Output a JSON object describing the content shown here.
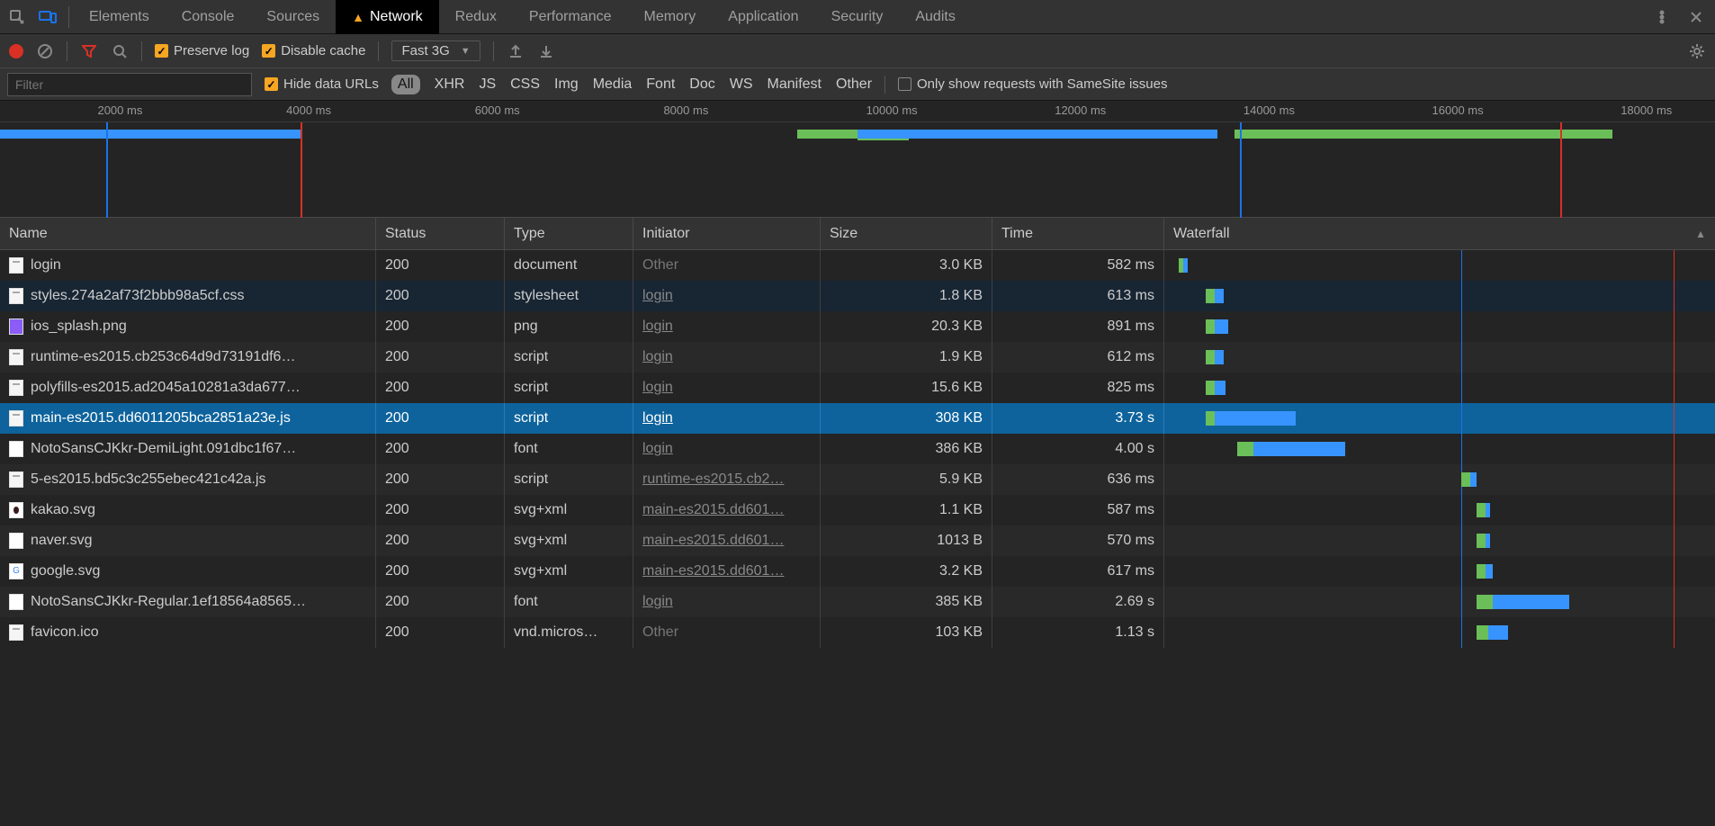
{
  "tabs": [
    "Elements",
    "Console",
    "Sources",
    "Network",
    "Redux",
    "Performance",
    "Memory",
    "Application",
    "Security",
    "Audits"
  ],
  "active_tab": "Network",
  "tab_has_warning": true,
  "toolbar": {
    "preserve_log": "Preserve log",
    "disable_cache": "Disable cache",
    "throttle": "Fast 3G"
  },
  "filter": {
    "placeholder": "Filter",
    "hide_data_urls": "Hide data URLs",
    "categories": [
      "All",
      "XHR",
      "JS",
      "CSS",
      "Img",
      "Media",
      "Font",
      "Doc",
      "WS",
      "Manifest",
      "Other"
    ],
    "active_category": "All",
    "samesite_label": "Only show requests with SameSite issues"
  },
  "timeline": {
    "ticks": [
      "2000 ms",
      "4000 ms",
      "6000 ms",
      "8000 ms",
      "10000 ms",
      "12000 ms",
      "14000 ms",
      "16000 ms",
      "18000 ms"
    ],
    "tick_positions_pct": [
      7,
      18,
      29,
      40,
      52,
      63,
      74,
      85,
      96
    ],
    "markers": [
      {
        "pos_pct": 6.2,
        "color": "#1a73e8"
      },
      {
        "pos_pct": 17.5,
        "color": "#d93025"
      },
      {
        "pos_pct": 72.3,
        "color": "#1a73e8"
      },
      {
        "pos_pct": 91,
        "color": "#d93025"
      }
    ],
    "bars": [
      {
        "left_pct": 0,
        "width_pct": 17.5,
        "color": "#3794ff"
      },
      {
        "left_pct": 46.5,
        "width_pct": 3.5,
        "color": "#6bbf59"
      },
      {
        "left_pct": 50,
        "width_pct": 3,
        "color": "#6bbf59",
        "h": 12
      },
      {
        "left_pct": 50,
        "width_pct": 21,
        "color": "#3794ff"
      },
      {
        "left_pct": 72,
        "width_pct": 22,
        "color": "#6bbf59"
      }
    ]
  },
  "columns": [
    "Name",
    "Status",
    "Type",
    "Initiator",
    "Size",
    "Time",
    "Waterfall"
  ],
  "sort_column": "Waterfall",
  "wf_markers": [
    {
      "pos_pct": 54,
      "color": "#1a73e8"
    },
    {
      "pos_pct": 94,
      "color": "#d93025"
    }
  ],
  "rows": [
    {
      "name": "login",
      "status": "200",
      "type": "document",
      "initiator": "Other",
      "init_link": false,
      "size": "3.0 KB",
      "time": "582 ms",
      "ico": "doc",
      "wf": {
        "l": 1,
        "w1": 2,
        "w2": 2
      }
    },
    {
      "name": "styles.274a2af73f2bbb98a5cf.css",
      "status": "200",
      "type": "stylesheet",
      "initiator": "login",
      "init_link": true,
      "size": "1.8 KB",
      "time": "613 ms",
      "ico": "doc",
      "hover_dark": true,
      "wf": {
        "l": 6,
        "w1": 4,
        "w2": 4
      }
    },
    {
      "name": "ios_splash.png",
      "status": "200",
      "type": "png",
      "initiator": "login",
      "init_link": true,
      "size": "20.3 KB",
      "time": "891 ms",
      "ico": "img",
      "wf": {
        "l": 6,
        "w1": 4,
        "w2": 6
      }
    },
    {
      "name": "runtime-es2015.cb253c64d9d73191df6…",
      "status": "200",
      "type": "script",
      "initiator": "login",
      "init_link": true,
      "size": "1.9 KB",
      "time": "612 ms",
      "ico": "doc",
      "wf": {
        "l": 6,
        "w1": 4,
        "w2": 4
      }
    },
    {
      "name": "polyfills-es2015.ad2045a10281a3da677…",
      "status": "200",
      "type": "script",
      "initiator": "login",
      "init_link": true,
      "size": "15.6 KB",
      "time": "825 ms",
      "ico": "doc",
      "wf": {
        "l": 6,
        "w1": 4,
        "w2": 5
      }
    },
    {
      "name": "main-es2015.dd6011205bca2851a23e.js",
      "status": "200",
      "type": "script",
      "initiator": "login",
      "init_link": true,
      "size": "308 KB",
      "time": "3.73 s",
      "ico": "doc",
      "selected": true,
      "wf": {
        "l": 6,
        "w1": 4,
        "w2": 36
      }
    },
    {
      "name": "NotoSansCJKkr-DemiLight.091dbc1f67…",
      "status": "200",
      "type": "font",
      "initiator": "login",
      "init_link": true,
      "size": "386 KB",
      "time": "4.00 s",
      "ico": "font",
      "wf": {
        "l": 12,
        "w1": 7,
        "w2": 41
      }
    },
    {
      "name": "5-es2015.bd5c3c255ebec421c42a.js",
      "status": "200",
      "type": "script",
      "initiator": "runtime-es2015.cb2…",
      "init_link": true,
      "size": "5.9 KB",
      "time": "636 ms",
      "ico": "doc",
      "wf": {
        "l": 54,
        "w1": 4,
        "w2": 3
      }
    },
    {
      "name": "kakao.svg",
      "status": "200",
      "type": "svg+xml",
      "initiator": "main-es2015.dd601…",
      "init_link": true,
      "size": "1.1 KB",
      "time": "587 ms",
      "ico": "kakao",
      "wf": {
        "l": 57,
        "w1": 4,
        "w2": 2
      }
    },
    {
      "name": "naver.svg",
      "status": "200",
      "type": "svg+xml",
      "initiator": "main-es2015.dd601…",
      "init_link": true,
      "size": "1013 B",
      "time": "570 ms",
      "ico": "font",
      "wf": {
        "l": 57,
        "w1": 4,
        "w2": 2
      }
    },
    {
      "name": "google.svg",
      "status": "200",
      "type": "svg+xml",
      "initiator": "main-es2015.dd601…",
      "init_link": true,
      "size": "3.2 KB",
      "time": "617 ms",
      "ico": "google",
      "wf": {
        "l": 57,
        "w1": 4,
        "w2": 3
      }
    },
    {
      "name": "NotoSansCJKkr-Regular.1ef18564a8565…",
      "status": "200",
      "type": "font",
      "initiator": "login",
      "init_link": true,
      "size": "385 KB",
      "time": "2.69 s",
      "ico": "font",
      "wf": {
        "l": 57,
        "w1": 7,
        "w2": 34
      }
    },
    {
      "name": "favicon.ico",
      "status": "200",
      "type": "vnd.micros…",
      "initiator": "Other",
      "init_link": false,
      "size": "103 KB",
      "time": "1.13 s",
      "ico": "doc",
      "wf": {
        "l": 57,
        "w1": 5,
        "w2": 9
      }
    }
  ]
}
